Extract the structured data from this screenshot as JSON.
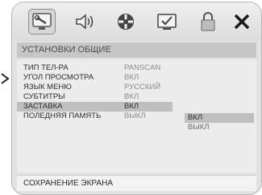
{
  "toolbar": {
    "items": [
      {
        "icon": "system-setup-icon",
        "active": true
      },
      {
        "icon": "audio-setup-icon",
        "active": false
      },
      {
        "icon": "video-setup-icon",
        "active": false
      },
      {
        "icon": "preference-icon",
        "active": false
      },
      {
        "icon": "lock-icon",
        "active": false
      },
      {
        "icon": "exit-icon",
        "active": false
      }
    ]
  },
  "section_title": "УСТАНОВКИ ОБЩИЕ",
  "menu": {
    "items": [
      {
        "label": "ТИП ТЕЛ-РА",
        "value": "PANSCAN"
      },
      {
        "label": "УГОЛ ПРОСМОТРА",
        "value": "ВКЛ"
      },
      {
        "label": "ЯЗЫК МЕНЮ",
        "value": "РУССКИЙ"
      },
      {
        "label": "СУБТИТРЫ",
        "value": "ВКЛ"
      },
      {
        "label": "ЗАСТАВКА",
        "value": "ВКЛ",
        "selected": true
      },
      {
        "label": "ПОЛЕДНЯЯ ПАМЯТЬ",
        "value": "ВЫКЛ"
      }
    ]
  },
  "submenu": {
    "options": [
      {
        "label": "ВКЛ",
        "selected": true
      },
      {
        "label": "ВЫКЛ",
        "selected": false
      }
    ]
  },
  "status_bar": "СОХРАНЕНИЕ ЭКРАНА",
  "colors": {
    "frame_bg": "#e2e2e2",
    "title_bar_bg": "#c6c6c6",
    "highlight_bg": "#bfbfbf",
    "exit_x": "#1a1a1a"
  }
}
